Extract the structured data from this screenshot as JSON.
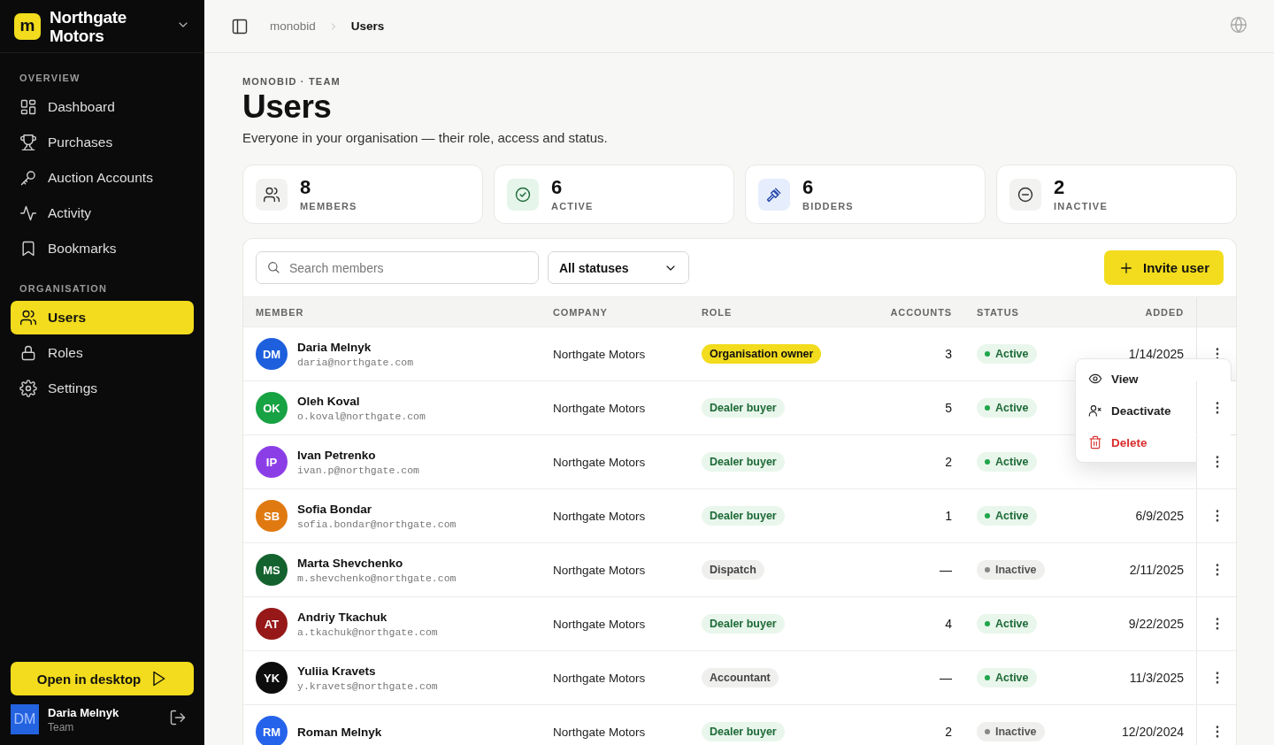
{
  "sidebar": {
    "brand": {
      "logo": "m",
      "name": "Northgate Motors"
    },
    "sections": [
      {
        "title": "OVERVIEW",
        "items": [
          {
            "label": "Dashboard",
            "selected": false
          },
          {
            "label": "Purchases",
            "selected": false
          },
          {
            "label": "Auction Accounts",
            "selected": false
          },
          {
            "label": "Activity",
            "selected": false
          },
          {
            "label": "Bookmarks",
            "selected": false
          }
        ]
      },
      {
        "title": "ORGANISATION",
        "items": [
          {
            "label": "Users",
            "selected": true
          },
          {
            "label": "Roles",
            "selected": false
          },
          {
            "label": "Settings",
            "selected": false
          }
        ]
      }
    ],
    "desktop_button": "Open in desktop",
    "user": {
      "initials": "DM",
      "name": "Daria Melnyk",
      "role": "Team"
    }
  },
  "breadcrumb": [
    "monobid",
    "Users"
  ],
  "page": {
    "eyebrow": "MONOBID · TEAM",
    "title": "Users",
    "subtitle": "Everyone in your organisation — their role, access and status."
  },
  "stats": [
    {
      "value": "8",
      "label": "MEMBERS"
    },
    {
      "value": "6",
      "label": "ACTIVE"
    },
    {
      "value": "6",
      "label": "BIDDERS"
    },
    {
      "value": "2",
      "label": "INACTIVE"
    }
  ],
  "toolbar": {
    "search_placeholder": "Search members",
    "status_filter": "All statuses",
    "invite_button": "Invite user"
  },
  "table": {
    "columns": [
      "MEMBER",
      "COMPANY",
      "ROLE",
      "ACCOUNTS",
      "STATUS",
      "ADDED"
    ],
    "rows": [
      {
        "initials": "DM",
        "color": "#1d5fdc",
        "name": "Daria Melnyk",
        "email": "daria@northgate.com",
        "company": "Northgate Motors",
        "role": {
          "label": "Organisation owner",
          "kind": "owner"
        },
        "accounts": "3",
        "status": {
          "label": "Active",
          "active": true
        },
        "added": "1/14/2025"
      },
      {
        "initials": "OK",
        "color": "#17a243",
        "name": "Oleh Koval",
        "email": "o.koval@northgate.com",
        "company": "Northgate Motors",
        "role": {
          "label": "Dealer buyer",
          "kind": "buyer"
        },
        "accounts": "5",
        "status": {
          "label": "Active",
          "active": true
        }
      },
      {
        "initials": "IP",
        "color": "#8b3ee6",
        "name": "Ivan Petrenko",
        "email": "ivan.p@northgate.com",
        "company": "Northgate Motors",
        "role": {
          "label": "Dealer buyer",
          "kind": "buyer"
        },
        "accounts": "2",
        "status": {
          "label": "Active",
          "active": true
        }
      },
      {
        "initials": "SB",
        "color": "#e07a10",
        "name": "Sofia Bondar",
        "email": "sofia.bondar@northgate.com",
        "company": "Northgate Motors",
        "role": {
          "label": "Dealer buyer",
          "kind": "buyer"
        },
        "accounts": "1",
        "status": {
          "label": "Active",
          "active": true
        },
        "added": "6/9/2025"
      },
      {
        "initials": "MS",
        "color": "#14632e",
        "name": "Marta Shevchenko",
        "email": "m.shevchenko@northgate.com",
        "company": "Northgate Motors",
        "role": {
          "label": "Dispatch",
          "kind": "neutral"
        },
        "accounts": "—",
        "status": {
          "label": "Inactive",
          "active": false
        },
        "added": "2/11/2025"
      },
      {
        "initials": "AT",
        "color": "#961818",
        "name": "Andriy Tkachuk",
        "email": "a.tkachuk@northgate.com",
        "company": "Northgate Motors",
        "role": {
          "label": "Dealer buyer",
          "kind": "buyer"
        },
        "accounts": "4",
        "status": {
          "label": "Active",
          "active": true
        },
        "added": "9/22/2025"
      },
      {
        "initials": "YK",
        "color": "#0d0d0d",
        "name": "Yuliia Kravets",
        "email": "y.kravets@northgate.com",
        "company": "Northgate Motors",
        "role": {
          "label": "Accountant",
          "kind": "neutral"
        },
        "accounts": "—",
        "status": {
          "label": "Active",
          "active": true
        },
        "added": "11/3/2025"
      },
      {
        "initials": "RM",
        "color": "#2563eb",
        "name": "Roman Melnyk",
        "company": "Northgate Motors",
        "role": {
          "label": "Dealer buyer",
          "kind": "buyer"
        },
        "accounts": "2",
        "status": {
          "label": "Inactive",
          "active": false
        },
        "added": "12/20/2024"
      }
    ]
  },
  "row_menu": {
    "items": [
      {
        "label": "View",
        "kind": "default"
      },
      {
        "label": "Deactivate",
        "kind": "default"
      },
      {
        "label": "Delete",
        "kind": "danger"
      }
    ]
  }
}
